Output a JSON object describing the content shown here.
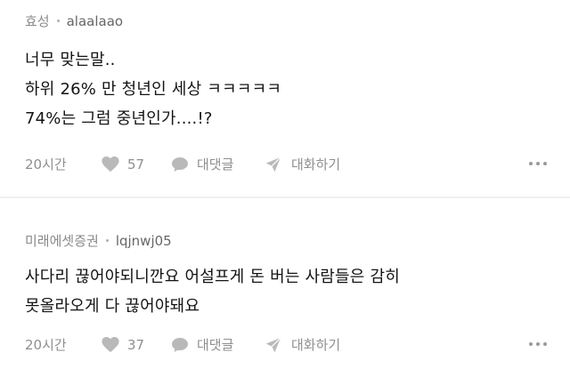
{
  "comments": [
    {
      "author": "효성",
      "username": "alaalaao",
      "lines": [
        "너무 맞는말..",
        "하위 26% 만 청년인 세상 ㅋㅋㅋㅋㅋ",
        "74%는 그럼 중년인가....!?"
      ],
      "time": "20시간",
      "likes": "57",
      "reply_label": "대댓글",
      "chat_label": "대화하기"
    },
    {
      "author": "미래에셋증권",
      "username": "lqjnwj05",
      "lines": [
        "사다리 끊어야되니깐요 어설프게 돈 버는 사람들은 감히",
        "못올라오게 다 끊어야돼요"
      ],
      "time": "20시간",
      "likes": "37",
      "reply_label": "대댓글",
      "chat_label": "대화하기"
    }
  ],
  "icons": {
    "like": "heart-icon",
    "reply": "speech-bubble-icon",
    "chat": "paper-plane-icon",
    "more": "more-dots-icon"
  }
}
